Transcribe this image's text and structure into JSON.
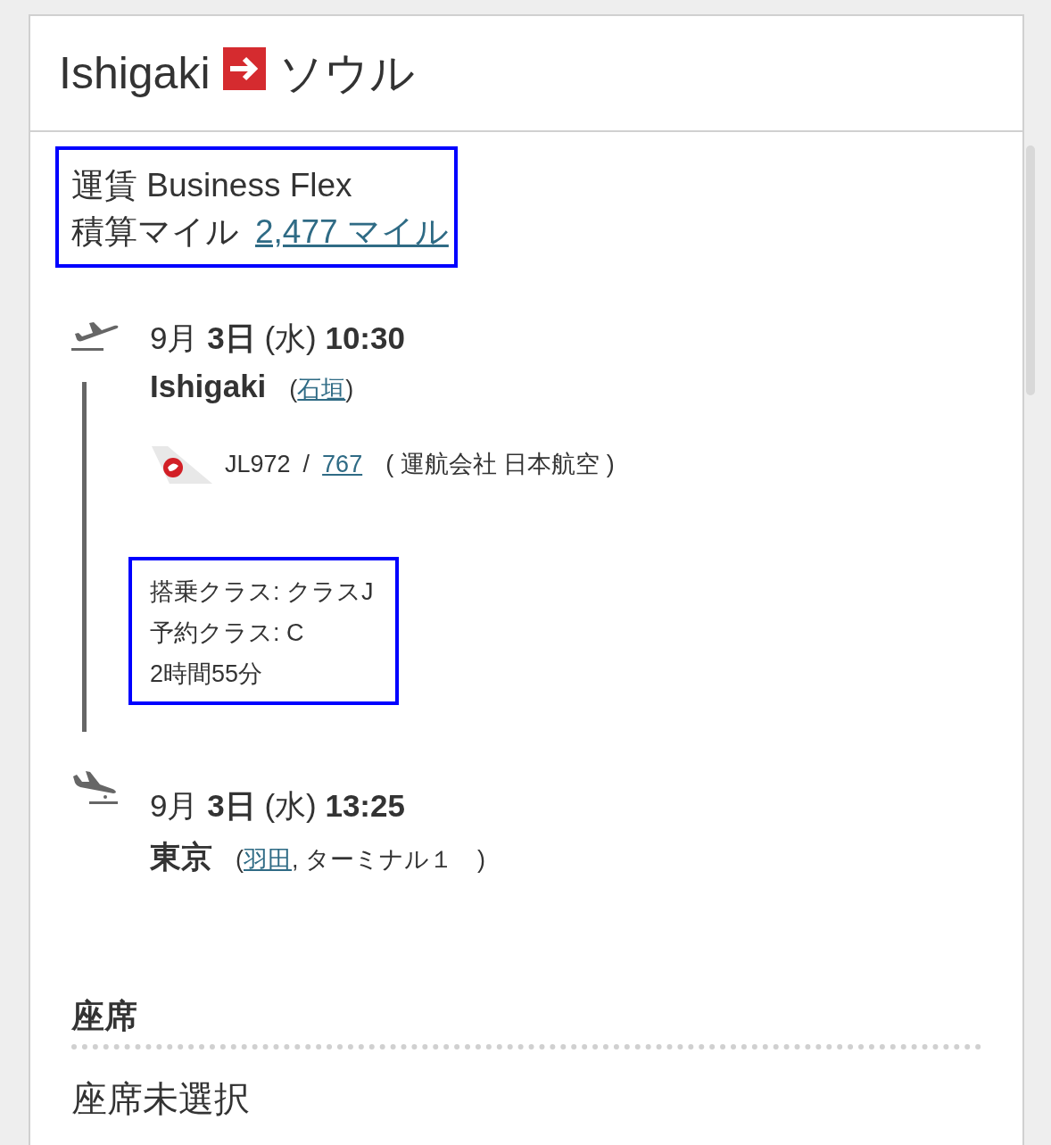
{
  "header": {
    "origin": "Ishigaki",
    "destination": "ソウル"
  },
  "fare_box": {
    "fare": "運賃 Business Flex",
    "miles_label": "積算マイル",
    "miles_link": "2,477 マイル"
  },
  "departure": {
    "date": "9月 **3日** (水) **10:30**",
    "city": "Ishigaki",
    "open": "(",
    "airport_link": "石垣",
    "close": ")"
  },
  "flight": {
    "number": "JL972",
    "separator": "/",
    "aircraft_link": "767",
    "operator": "( 運航会社 日本航空 )"
  },
  "class_box": [
    "搭乗クラス: クラスJ",
    "予約クラス: C",
    "2時間55分"
  ],
  "arrival": {
    "date": "9月 **3日** (水) **13:25**",
    "city": "東京",
    "open": "(",
    "airport_link": "羽田",
    "close": ",  ターミナル１　)"
  },
  "seat": {
    "heading": "座席",
    "value": "座席未選択"
  }
}
